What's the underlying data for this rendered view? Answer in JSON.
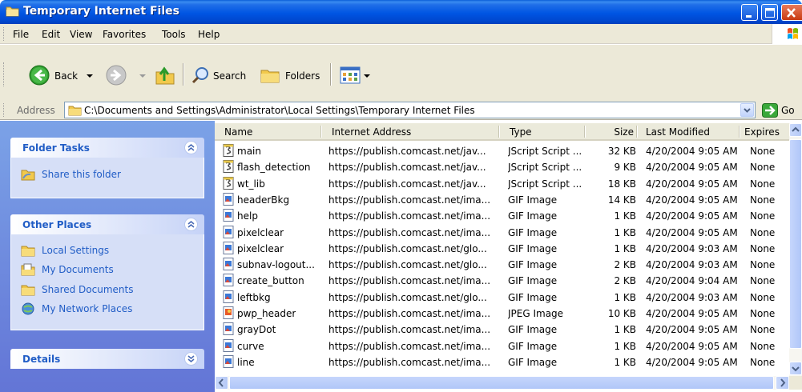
{
  "window": {
    "title": "Temporary Internet Files"
  },
  "menu": [
    "File",
    "Edit",
    "View",
    "Favorites",
    "Tools",
    "Help"
  ],
  "toolbar": {
    "back_label": "Back",
    "search_label": "Search",
    "folders_label": "Folders"
  },
  "address": {
    "label": "Address",
    "path": "C:\\Documents and Settings\\Administrator\\Local Settings\\Temporary Internet Files",
    "go_label": "Go"
  },
  "taskpane": {
    "folder_tasks": {
      "title": "Folder Tasks",
      "items": [
        "Share this folder"
      ]
    },
    "other_places": {
      "title": "Other Places",
      "items": [
        "Local Settings",
        "My Documents",
        "Shared Documents",
        "My Network Places"
      ]
    },
    "details": {
      "title": "Details"
    }
  },
  "list": {
    "columns": [
      "Name",
      "Internet Address",
      "Type",
      "Size",
      "Last Modified",
      "Expires"
    ],
    "rows": [
      {
        "icon": "jscript-file-icon",
        "name": "main",
        "address": "https://publish.comcast.net/jav...",
        "type": "JScript Script ...",
        "size": "32 KB",
        "modified": "4/20/2004 9:05 AM",
        "expires": "None"
      },
      {
        "icon": "jscript-file-icon",
        "name": "flash_detection",
        "address": "https://publish.comcast.net/jav...",
        "type": "JScript Script ...",
        "size": "9 KB",
        "modified": "4/20/2004 9:05 AM",
        "expires": "None"
      },
      {
        "icon": "jscript-file-icon",
        "name": "wt_lib",
        "address": "https://publish.comcast.net/jav...",
        "type": "JScript Script ...",
        "size": "18 KB",
        "modified": "4/20/2004 9:05 AM",
        "expires": "None"
      },
      {
        "icon": "gif-image-icon",
        "name": "headerBkg",
        "address": "https://publish.comcast.net/ima...",
        "type": "GIF Image",
        "size": "14 KB",
        "modified": "4/20/2004 9:05 AM",
        "expires": "None"
      },
      {
        "icon": "gif-image-icon",
        "name": "help",
        "address": "https://publish.comcast.net/ima...",
        "type": "GIF Image",
        "size": "1 KB",
        "modified": "4/20/2004 9:05 AM",
        "expires": "None"
      },
      {
        "icon": "gif-image-icon",
        "name": "pixelclear",
        "address": "https://publish.comcast.net/ima...",
        "type": "GIF Image",
        "size": "1 KB",
        "modified": "4/20/2004 9:05 AM",
        "expires": "None"
      },
      {
        "icon": "gif-image-icon",
        "name": "pixelclear",
        "address": "https://publish.comcast.net/glo...",
        "type": "GIF Image",
        "size": "1 KB",
        "modified": "4/20/2004 9:03 AM",
        "expires": "None"
      },
      {
        "icon": "gif-image-icon",
        "name": "subnav-logout...",
        "address": "https://publish.comcast.net/glo...",
        "type": "GIF Image",
        "size": "2 KB",
        "modified": "4/20/2004 9:03 AM",
        "expires": "None"
      },
      {
        "icon": "gif-image-icon",
        "name": "create_button",
        "address": "https://publish.comcast.net/ima...",
        "type": "GIF Image",
        "size": "2 KB",
        "modified": "4/20/2004 9:04 AM",
        "expires": "None"
      },
      {
        "icon": "gif-image-icon",
        "name": "leftbkg",
        "address": "https://publish.comcast.net/glo...",
        "type": "GIF Image",
        "size": "1 KB",
        "modified": "4/20/2004 9:03 AM",
        "expires": "None"
      },
      {
        "icon": "jpeg-image-icon",
        "name": "pwp_header",
        "address": "https://publish.comcast.net/ima...",
        "type": "JPEG Image",
        "size": "10 KB",
        "modified": "4/20/2004 9:05 AM",
        "expires": "None"
      },
      {
        "icon": "gif-image-icon",
        "name": "grayDot",
        "address": "https://publish.comcast.net/ima...",
        "type": "GIF Image",
        "size": "1 KB",
        "modified": "4/20/2004 9:05 AM",
        "expires": "None"
      },
      {
        "icon": "gif-image-icon",
        "name": "curve",
        "address": "https://publish.comcast.net/ima...",
        "type": "GIF Image",
        "size": "1 KB",
        "modified": "4/20/2004 9:05 AM",
        "expires": "None"
      },
      {
        "icon": "gif-image-icon",
        "name": "line",
        "address": "https://publish.comcast.net/ima...",
        "type": "GIF Image",
        "size": "1 KB",
        "modified": "4/20/2004 9:05 AM",
        "expires": "None"
      }
    ]
  },
  "colors": {
    "title_blue": "#0055e3",
    "task_link": "#215dc6",
    "taskpane_bg": "#7ba2e7",
    "chrome": "#ece9d8"
  }
}
